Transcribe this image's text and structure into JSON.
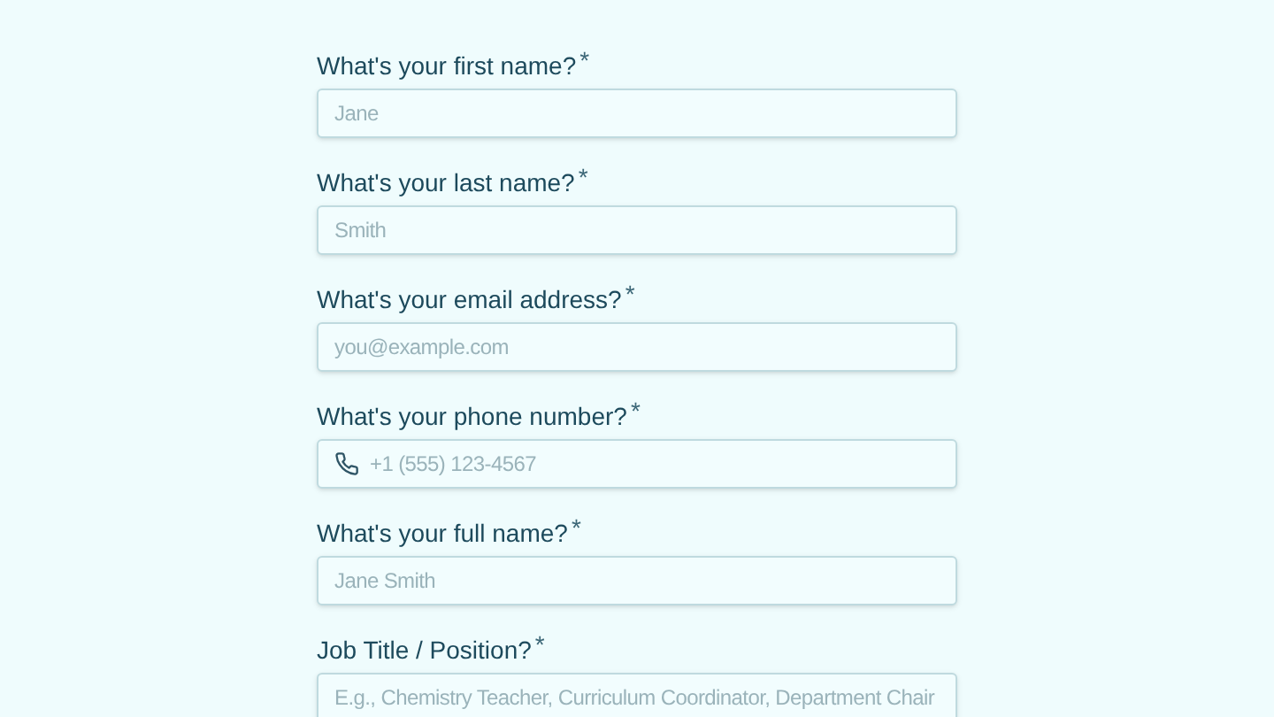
{
  "fields": [
    {
      "kind": "text",
      "label": "What's your first name?",
      "required_mark": "*",
      "placeholder": "Jane"
    },
    {
      "kind": "text",
      "label": "What's your last name?",
      "required_mark": "*",
      "placeholder": "Smith"
    },
    {
      "kind": "text",
      "label": "What's your email address?",
      "required_mark": "*",
      "placeholder": "you@example.com"
    },
    {
      "kind": "phone",
      "label": "What's your phone number?",
      "required_mark": "*",
      "placeholder": "+1 (555) 123-4567"
    },
    {
      "kind": "text",
      "label": "What's your full name?",
      "required_mark": "*",
      "placeholder": "Jane Smith"
    },
    {
      "kind": "text",
      "label": "Job Title / Position?",
      "required_mark": "*",
      "placeholder": "E.g., Chemistry Teacher, Curriculum Coordinator, Department Chair"
    }
  ]
}
